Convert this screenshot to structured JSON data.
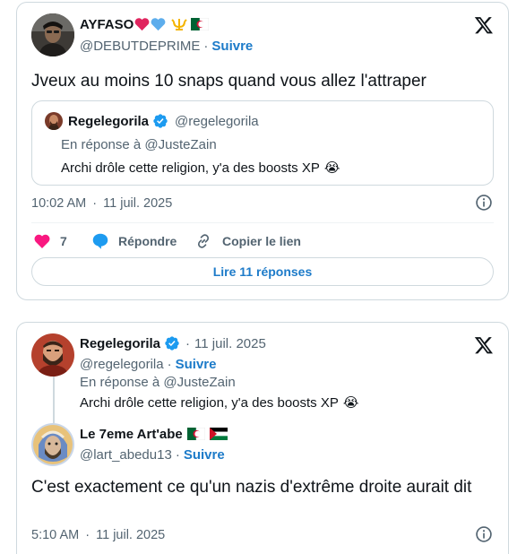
{
  "tweet1": {
    "author_name": "AYFASO",
    "author_handle": "@DEBUTDEPRIME",
    "follow_sep": "·",
    "follow_label": "Suivre",
    "text": "Jveux au moins 10 snaps quand vous allez l'attraper",
    "quoted": {
      "author_name": "Regelegorila",
      "author_handle": "@regelegorila",
      "reply_to": "En réponse à @JusteZain",
      "text": "Archi drôle cette religion, y'a des boosts XP",
      "emoji": "😭"
    },
    "time": "10:02 AM",
    "date_sep": "·",
    "date": "11 juil. 2025",
    "likes": "7",
    "reply_label": "Répondre",
    "copy_link_label": "Copier le lien",
    "read_replies_label": "Lire 11 réponses"
  },
  "tweet2": {
    "parent": {
      "author_name": "Regelegorila",
      "date_sep": "·",
      "date": "11 juil. 2025",
      "author_handle": "@regelegorila",
      "follow_sep": "·",
      "follow_label": "Suivre",
      "reply_to": "En réponse à @JusteZain",
      "text": "Archi drôle cette religion, y'a des boosts XP",
      "emoji": "😭"
    },
    "reply": {
      "author_name": "Le 7eme Art'abe",
      "author_handle": "@lart_abedu13",
      "follow_sep": "·",
      "follow_label": "Suivre",
      "text": "C'est exactement ce qu'un nazis d'extrême droite aurait dit",
      "time": "5:10 AM",
      "date_sep": "·",
      "date": "11 juil. 2025"
    }
  },
  "colors": {
    "follow_blue": "#1d7bc9",
    "verified_blue": "#1d9bf0",
    "like_pink": "#f91880",
    "secondary_text": "#536471",
    "border": "#cfd9de"
  },
  "icons": {
    "close": "x-logo-icon",
    "info": "info-circle-icon",
    "like": "heart-icon",
    "reply": "speech-bubble-icon",
    "copy_link": "link-icon",
    "verified": "verified-badge-icon"
  }
}
